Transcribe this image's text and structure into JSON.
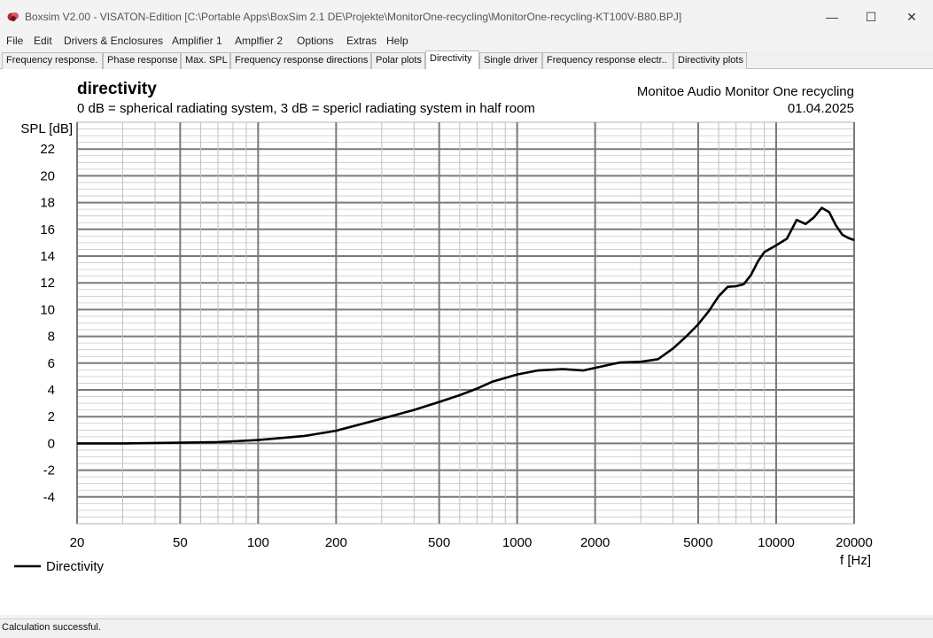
{
  "window": {
    "title": "Boxsim V2.00 - VISATON-Edition [C:\\Portable Apps\\BoxSim 2.1 DE\\Projekte\\MonitorOne-recycling\\MonitorOne-recycling-KT100V-B80.BPJ]",
    "icon": "boxsim-app-icon",
    "minimize_glyph": "—",
    "maximize_glyph": "☐",
    "close_glyph": "✕"
  },
  "menu": {
    "items": [
      "File",
      "Edit",
      "Drivers & Enclosures",
      "Amplifier 1",
      "Amplfier 2",
      "Options",
      "Extras",
      "Help"
    ]
  },
  "tabs": {
    "items": [
      "Frequency response.",
      "Phase response",
      "Max. SPL",
      "Frequency response directions",
      "Polar plots",
      "Directivity",
      "Single driver",
      "Frequency response electr..",
      "Directivity plots"
    ],
    "active": "Directivity"
  },
  "plot": {
    "title": "directivity",
    "subtitle": "0 dB = spherical radiating system, 3 dB = spericl radiating system in half room",
    "project_name": "Monitoe Audio Monitor One recycling",
    "date": "01.04.2025",
    "legend_label": "Directivity"
  },
  "chart_data": {
    "type": "line",
    "title": "directivity",
    "xlabel": "f [Hz]",
    "ylabel": "SPL [dB]",
    "xscale": "log",
    "xlim": [
      20,
      20000
    ],
    "ylim": [
      -6,
      24
    ],
    "x_ticks": [
      20,
      50,
      100,
      200,
      500,
      1000,
      2000,
      5000,
      10000,
      20000
    ],
    "y_ticks": [
      -4,
      -2,
      0,
      2,
      4,
      6,
      8,
      10,
      12,
      14,
      16,
      18,
      20,
      22
    ],
    "grid": true,
    "legend_position": "bottom-left",
    "series": [
      {
        "name": "Directivity",
        "color": "#000000",
        "x": [
          20,
          30,
          50,
          70,
          100,
          150,
          200,
          300,
          400,
          500,
          600,
          700,
          800,
          1000,
          1200,
          1500,
          1800,
          2000,
          2500,
          3000,
          3500,
          4000,
          4500,
          5000,
          5500,
          6000,
          6500,
          7000,
          7500,
          8000,
          8500,
          9000,
          10000,
          11000,
          12000,
          13000,
          14000,
          15000,
          16000,
          17000,
          18000,
          19000,
          20000
        ],
        "y": [
          0,
          0,
          0.05,
          0.1,
          0.25,
          0.55,
          0.95,
          1.85,
          2.5,
          3.1,
          3.6,
          4.1,
          4.6,
          5.15,
          5.45,
          5.55,
          5.45,
          5.65,
          6.05,
          6.1,
          6.3,
          7.1,
          8.0,
          8.9,
          9.9,
          11.0,
          11.7,
          11.75,
          11.9,
          12.6,
          13.6,
          14.3,
          14.8,
          15.3,
          16.7,
          16.4,
          16.9,
          17.6,
          17.3,
          16.3,
          15.6,
          15.35,
          15.2
        ]
      }
    ]
  },
  "status": {
    "text": "Calculation successful."
  }
}
